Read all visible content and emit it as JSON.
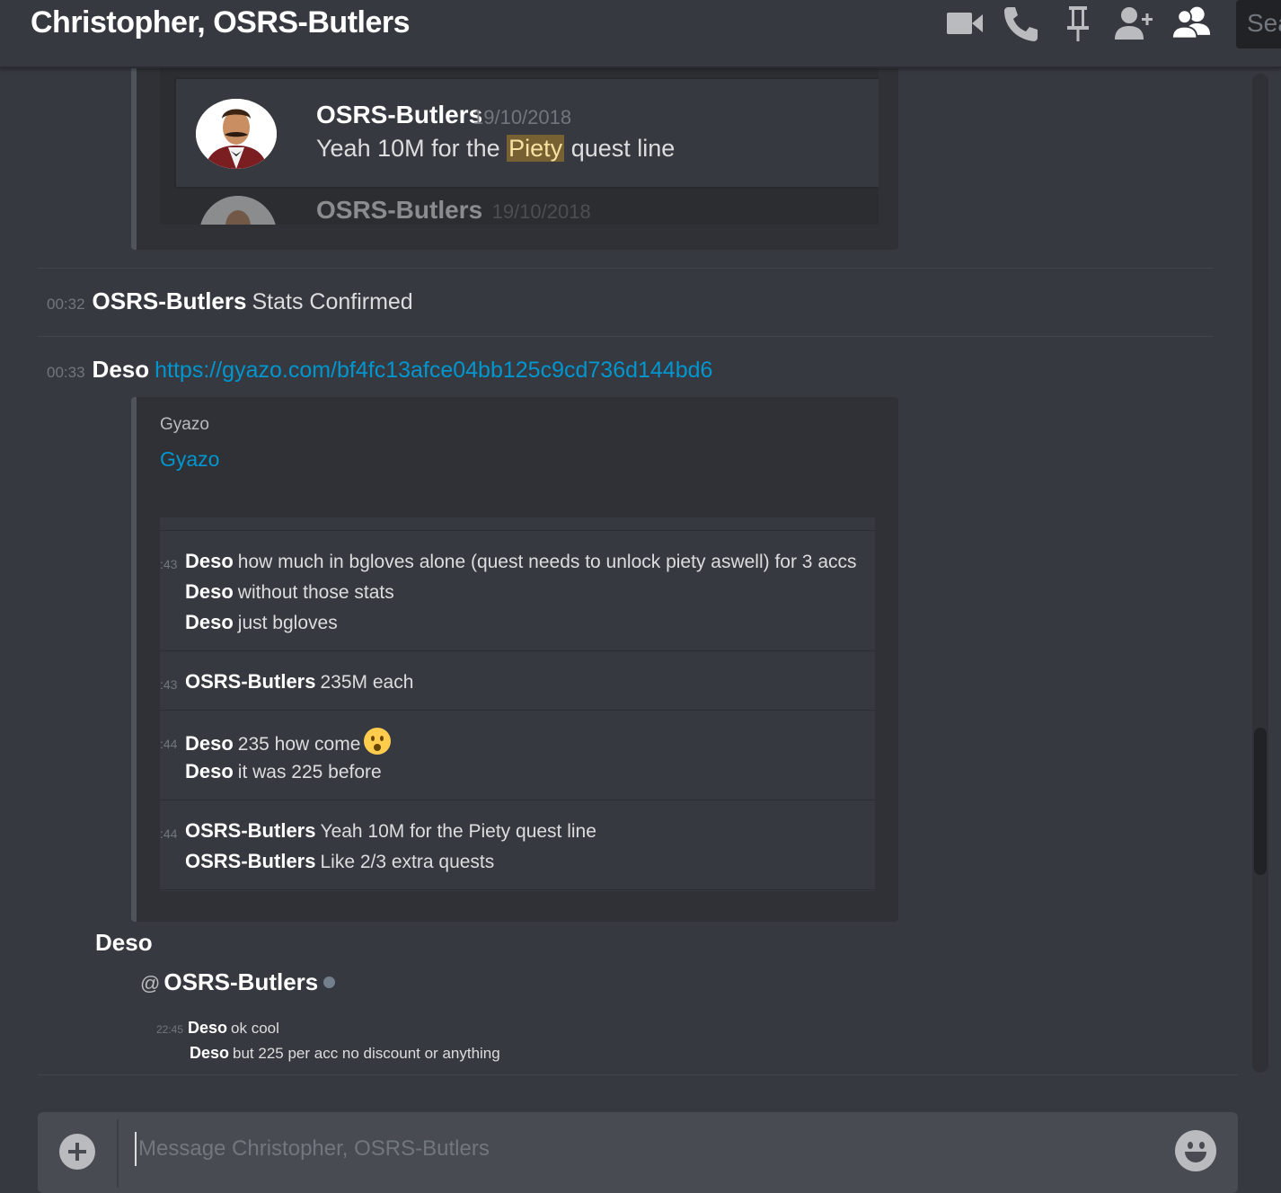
{
  "header": {
    "title": "Christopher, OSRS-Butlers",
    "search_label": "Sea",
    "icons": [
      "video-call-icon",
      "voice-call-icon",
      "pin-icon",
      "add-friend-icon",
      "members-icon"
    ]
  },
  "top_embed": {
    "author": "OSRS-Butlers",
    "date": "19/10/2018",
    "text_before": "Yeah 10M for the ",
    "highlight": "Piety",
    "text_after": " quest line",
    "next_author": "OSRS-Butlers",
    "next_date": "19/10/2018"
  },
  "messages": [
    {
      "time": "00:32",
      "author": "OSRS-Butlers",
      "text": "Stats Confirmed"
    },
    {
      "time": "00:33",
      "author": "Deso",
      "link": "https://gyazo.com/bf4fc13afce04bb125c9cd736d144bd6"
    }
  ],
  "gyazo_embed": {
    "provider": "Gyazo",
    "title": "Gyazo",
    "groups": [
      {
        "time": ":43",
        "lines": [
          {
            "author": "Deso",
            "text": "how much in bgloves alone (quest needs to unlock piety aswell) for 3 accs"
          },
          {
            "author": "Deso",
            "text": "without those stats"
          },
          {
            "author": "Deso",
            "text": "just bgloves"
          }
        ]
      },
      {
        "time": ":43",
        "lines": [
          {
            "author": "OSRS-Butlers",
            "text": "235M each"
          }
        ]
      },
      {
        "time": ":44",
        "lines": [
          {
            "author": "Deso",
            "text": "235 how come"
          },
          {
            "author": "Deso",
            "text": "it was 225 before"
          }
        ]
      },
      {
        "time": ":44",
        "lines": [
          {
            "author": "OSRS-Butlers",
            "text": "Yeah 10M for the Piety quest line"
          },
          {
            "author": "OSRS-Butlers",
            "text": "Like 2/3 extra quests"
          }
        ]
      }
    ]
  },
  "quoted_dm": {
    "author": "Deso",
    "at": "@",
    "recipient": "OSRS-Butlers",
    "lines": [
      {
        "time": "22:45",
        "author": "Deso",
        "text": "ok cool"
      },
      {
        "time": "",
        "author": "Deso",
        "text": "but 225 per acc no discount or anything"
      }
    ]
  },
  "composer": {
    "placeholder": "Message Christopher, OSRS-Butlers"
  },
  "colors": {
    "background": "#36393f",
    "link": "#0096cf",
    "highlight": "#776032"
  }
}
